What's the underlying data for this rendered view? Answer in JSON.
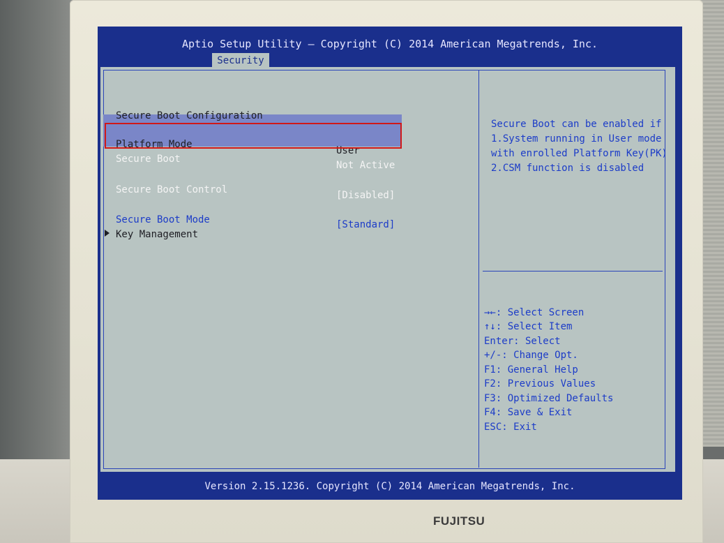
{
  "header": {
    "title": "Aptio Setup Utility – Copyright (C) 2014 American Megatrends, Inc.",
    "active_tab": "Security"
  },
  "main": {
    "section_title": "Secure Boot Configuration",
    "platform_mode": {
      "label": "Platform Mode",
      "value": "User"
    },
    "secure_boot": {
      "label": "Secure Boot",
      "value": "Not Active"
    },
    "secure_boot_control": {
      "label": "Secure Boot Control",
      "value": "[Disabled]"
    },
    "secure_boot_mode": {
      "label": "Secure Boot Mode",
      "value": "[Standard]"
    },
    "key_management": {
      "label": "Key Management"
    }
  },
  "help": {
    "lines": [
      "Secure Boot can be enabled if",
      "1.System running in User mode",
      "with enrolled Platform Key(PK)",
      "2.CSM function is disabled"
    ]
  },
  "keys": [
    "→←: Select Screen",
    "↑↓: Select Item",
    "Enter: Select",
    "+/-: Change Opt.",
    "F1: General Help",
    "F2: Previous Values",
    "F3: Optimized Defaults",
    "F4: Save & Exit",
    "ESC: Exit"
  ],
  "footer": {
    "version": "Version 2.15.1236. Copyright (C) 2014 American Megatrends, Inc."
  },
  "monitor": {
    "brand": "FUJITSU"
  },
  "colors": {
    "bios_blue": "#1a2f8c",
    "panel_gray": "#b8c4c2",
    "highlight": "#7a86c8",
    "annotation_red": "#d01818"
  }
}
